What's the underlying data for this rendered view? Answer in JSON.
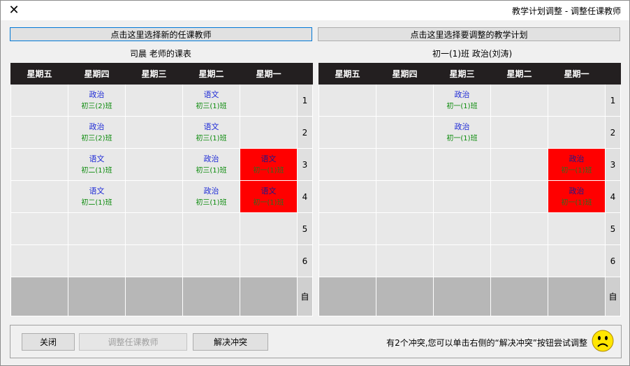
{
  "window": {
    "title": "教学计划调整 - 调整任课教师"
  },
  "buttons": {
    "select_teacher": "点击这里选择新的任课教师",
    "select_plan": "点击这里选择要调整的教学计划",
    "close": "关闭",
    "adjust": "调整任课教师",
    "resolve": "解决冲突"
  },
  "left_panel": {
    "caption": "司晨 老师的课表",
    "headers": [
      "星期五",
      "星期四",
      "星期三",
      "星期二",
      "星期一"
    ],
    "rows": [
      {
        "label": "1",
        "cells": [
          null,
          {
            "s": "政治",
            "c": "初三(2)班"
          },
          null,
          {
            "s": "语文",
            "c": "初三(1)班"
          },
          null
        ]
      },
      {
        "label": "2",
        "cells": [
          null,
          {
            "s": "政治",
            "c": "初三(2)班"
          },
          null,
          {
            "s": "语文",
            "c": "初三(1)班"
          },
          null
        ]
      },
      {
        "label": "3",
        "cells": [
          null,
          {
            "s": "语文",
            "c": "初二(1)班"
          },
          null,
          {
            "s": "政治",
            "c": "初三(1)班"
          },
          {
            "s": "语文",
            "c": "初一(1)班",
            "conflict": true
          }
        ]
      },
      {
        "label": "4",
        "cells": [
          null,
          {
            "s": "语文",
            "c": "初二(1)班"
          },
          null,
          {
            "s": "政治",
            "c": "初三(1)班"
          },
          {
            "s": "语文",
            "c": "初一(1)班",
            "conflict": true
          }
        ]
      },
      {
        "label": "5",
        "cells": [
          null,
          null,
          null,
          null,
          null
        ]
      },
      {
        "label": "6",
        "cells": [
          null,
          null,
          null,
          null,
          null
        ]
      },
      {
        "label": "自",
        "cells": [
          null,
          null,
          null,
          null,
          null
        ]
      }
    ]
  },
  "right_panel": {
    "caption": "初一(1)班 政治(刘涛)",
    "headers": [
      "星期五",
      "星期四",
      "星期三",
      "星期二",
      "星期一"
    ],
    "rows": [
      {
        "label": "1",
        "cells": [
          null,
          null,
          {
            "s": "政治",
            "c": "初一(1)班"
          },
          null,
          null
        ]
      },
      {
        "label": "2",
        "cells": [
          null,
          null,
          {
            "s": "政治",
            "c": "初一(1)班"
          },
          null,
          null
        ]
      },
      {
        "label": "3",
        "cells": [
          null,
          null,
          null,
          null,
          {
            "s": "政治",
            "c": "初一(1)班",
            "conflict": true
          }
        ]
      },
      {
        "label": "4",
        "cells": [
          null,
          null,
          null,
          null,
          {
            "s": "政治",
            "c": "初一(1)班",
            "conflict": true
          }
        ]
      },
      {
        "label": "5",
        "cells": [
          null,
          null,
          null,
          null,
          null
        ]
      },
      {
        "label": "6",
        "cells": [
          null,
          null,
          null,
          null,
          null
        ]
      },
      {
        "label": "自",
        "cells": [
          null,
          null,
          null,
          null,
          null
        ]
      }
    ]
  },
  "status": {
    "message": "有2个冲突,您可以单击右侧的“解决冲突”按钮尝试调整",
    "icon": "sad-face-icon"
  },
  "colors": {
    "conflict": "#ff0000",
    "header": "#231f20",
    "subject": "#1f2bd6",
    "class": "#0a8a0a"
  }
}
